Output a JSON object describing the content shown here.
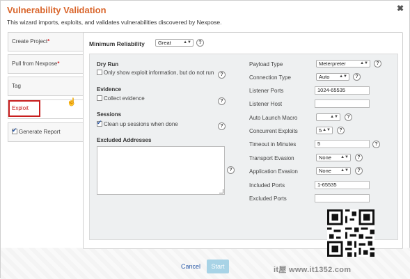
{
  "header": {
    "title": "Vulnerability Validation",
    "subtitle": "This wizard imports, exploits, and validates vulnerabilities discovered by Nexpose.",
    "close_glyph": "✖"
  },
  "steps": [
    {
      "label": "Create Project",
      "required": "*"
    },
    {
      "label": "Pull from Nexpose",
      "required": "*"
    },
    {
      "label": "Tag"
    },
    {
      "label": "Exploit"
    },
    {
      "label": "Generate Report"
    }
  ],
  "reliability": {
    "label": "Minimum Reliability",
    "value": "Great"
  },
  "dry_run": {
    "title": "Dry Run",
    "option": "Only show exploit information, but do not run",
    "checked": false
  },
  "evidence": {
    "title": "Evidence",
    "option": "Collect evidence",
    "checked": false
  },
  "sessions": {
    "title": "Sessions",
    "option": "Clean up sessions when done",
    "checked": true
  },
  "excluded_addresses": {
    "title": "Excluded Addresses"
  },
  "right_fields": {
    "payload_type": {
      "label": "Payload Type",
      "value": "Meterpreter"
    },
    "connection_type": {
      "label": "Connection Type",
      "value": "Auto"
    },
    "listener_ports": {
      "label": "Listener Ports",
      "value": "1024-65535"
    },
    "listener_host": {
      "label": "Listener Host",
      "value": ""
    },
    "auto_launch_macro": {
      "label": "Auto Launch Macro",
      "value": ""
    },
    "concurrent_exploits": {
      "label": "Concurrent Exploits",
      "value": "5"
    },
    "timeout": {
      "label": "Timeout in Minutes",
      "value": "5"
    },
    "transport_evasion": {
      "label": "Transport Evasion",
      "value": "None"
    },
    "application_evasion": {
      "label": "Application Evasion",
      "value": "None"
    },
    "included_ports": {
      "label": "Included Ports",
      "value": "1-65535"
    },
    "excluded_ports": {
      "label": "Excluded Ports",
      "value": ""
    }
  },
  "help_glyph": "?",
  "arrow_glyph": "▲▼",
  "footer": {
    "cancel": "Cancel",
    "start": "Start"
  },
  "watermark": "it屋 www.it1352.com",
  "colors": {
    "accent": "#d9652b",
    "required": "#d9262b",
    "active_outline": "#c81e1e",
    "start_button": "#a8d3e6"
  }
}
